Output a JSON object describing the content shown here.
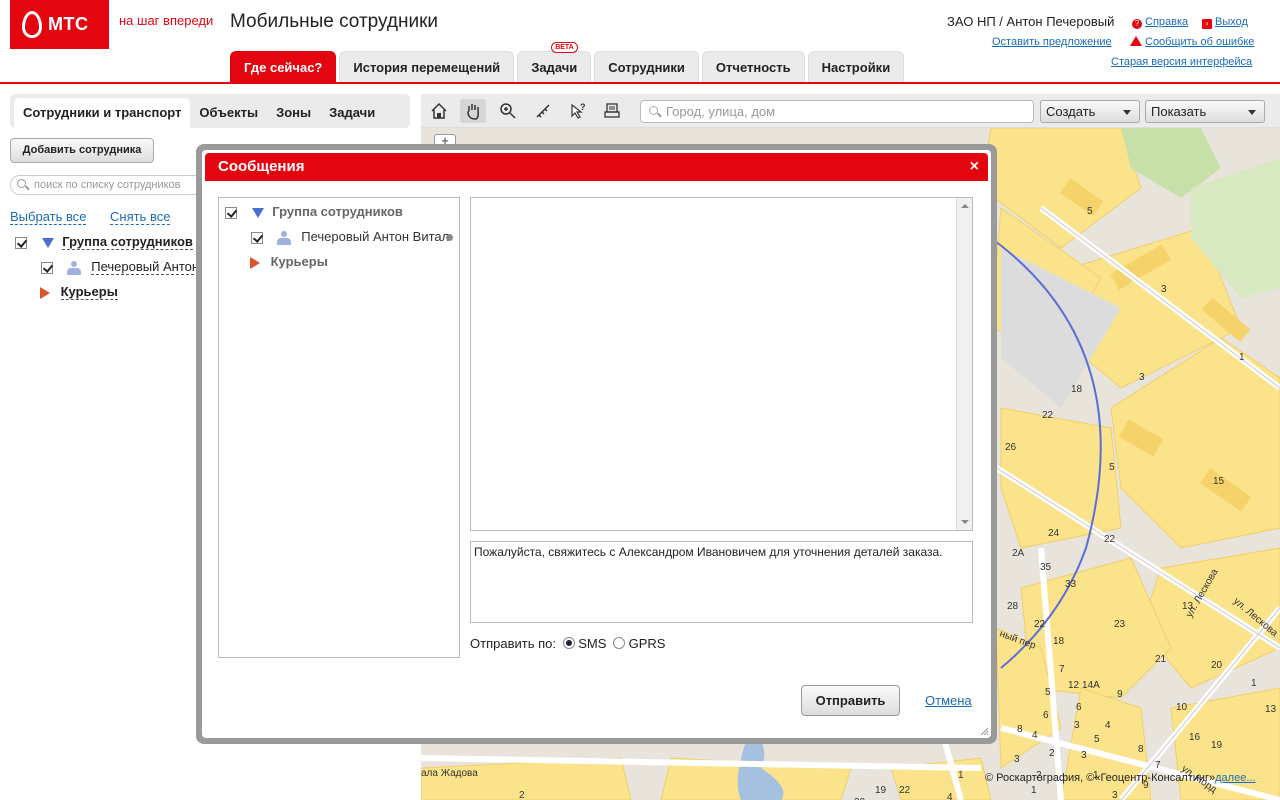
{
  "header": {
    "logo_text": "МТС",
    "slogan": "на шаг впереди",
    "app_title": "Мобильные сотрудники",
    "user": "ЗАО НП / Антон Печеровый",
    "help_label": "Справка",
    "logout_label": "Выход",
    "suggestion_label": "Оставить предложение",
    "report_error_label": "Сообщить об ошибке",
    "old_version_label": "Старая версия интерфейса",
    "accent_color": "#e30611"
  },
  "main_tabs": [
    {
      "label": "Где сейчас?",
      "active": true
    },
    {
      "label": "История перемещений"
    },
    {
      "label": "Задачи",
      "badge": "BETA"
    },
    {
      "label": "Сотрудники"
    },
    {
      "label": "Отчетность"
    },
    {
      "label": "Настройки"
    }
  ],
  "left_panel": {
    "tabs": [
      {
        "label": "Сотрудники и транспорт",
        "active": true
      },
      {
        "label": "Объекты"
      },
      {
        "label": "Зоны"
      },
      {
        "label": "Задачи"
      }
    ],
    "add_button": "Добавить сотрудника",
    "search_placeholder": "поиск по списку сотрудников",
    "select_all": "Выбрать все",
    "deselect_all": "Снять все",
    "tree": {
      "group1": "Группа сотрудников",
      "employee1": "Печеровый Антон",
      "group2": "Курьеры"
    }
  },
  "map": {
    "search_placeholder": "Город, улица, дом",
    "create_label": "Создать",
    "show_label": "Показать",
    "copyright": "© Роскартография, ©«Геоцентр-Консалтинг»",
    "more_link": "далее...",
    "house_numbers": [
      "5",
      "3",
      "1",
      "3",
      "18",
      "22",
      "26",
      "5",
      "15",
      "24",
      "22",
      "2A",
      "35",
      "33",
      "28",
      "22",
      "23",
      "13",
      "18",
      "7",
      "14A",
      "9",
      "12",
      "5",
      "6",
      "3",
      "21",
      "20",
      "10",
      "1",
      "8",
      "6",
      "4",
      "2",
      "3",
      "1",
      "4",
      "5",
      "3",
      "8",
      "7",
      "9",
      "16",
      "19",
      "13",
      "2",
      "19",
      "20",
      "21",
      "22",
      "1",
      "4",
      "3",
      "1",
      "2"
    ],
    "street_labels": [
      "ул. Лескова",
      "ул. Лескова",
      "ный пер",
      "ала Жадова",
      "ул. Норд"
    ],
    "zoom_in": "+"
  },
  "modal": {
    "title": "Сообщения",
    "close": "×",
    "recipients": {
      "group1": "Группа сотрудников",
      "employee1": "Печеровый Антон Витал",
      "group2": "Курьеры"
    },
    "message_text": "Пожалуйста, свяжитесь с Александром Ивановичем для уточнения деталей заказа.",
    "send_via_label": "Отправить по:",
    "sms_label": "SMS",
    "gprs_label": "GPRS",
    "selected_channel": "SMS",
    "send_button": "Отправить",
    "cancel_link": "Отмена"
  }
}
